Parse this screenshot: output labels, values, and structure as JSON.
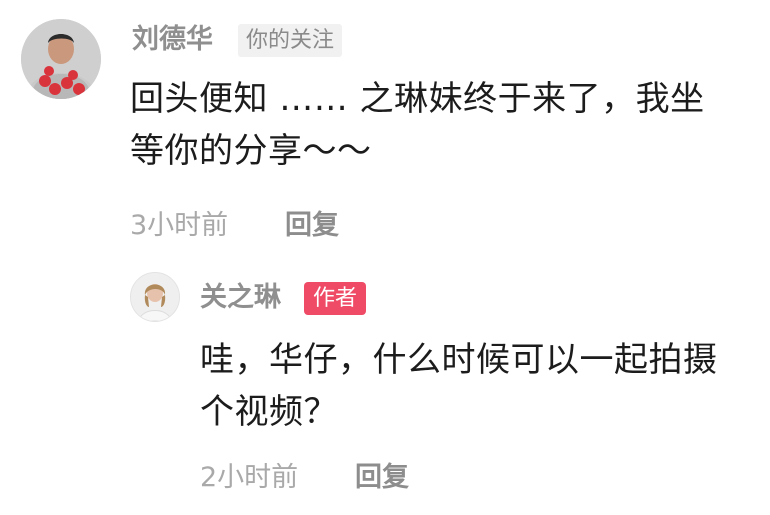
{
  "comment": {
    "author": "刘德华",
    "follow_badge": "你的关注",
    "text_lines": [
      "回头便知 …… 之琳妹终于来了，我坐",
      "等你的分享～～"
    ],
    "time": "3小时前",
    "reply_label": "回复"
  },
  "reply": {
    "author": "关之琳",
    "author_badge": "作者",
    "text_lines": [
      "哇，华仔，什么时候可以一起拍摄",
      "个视频？"
    ],
    "time": "2小时前",
    "reply_label": "回复"
  }
}
